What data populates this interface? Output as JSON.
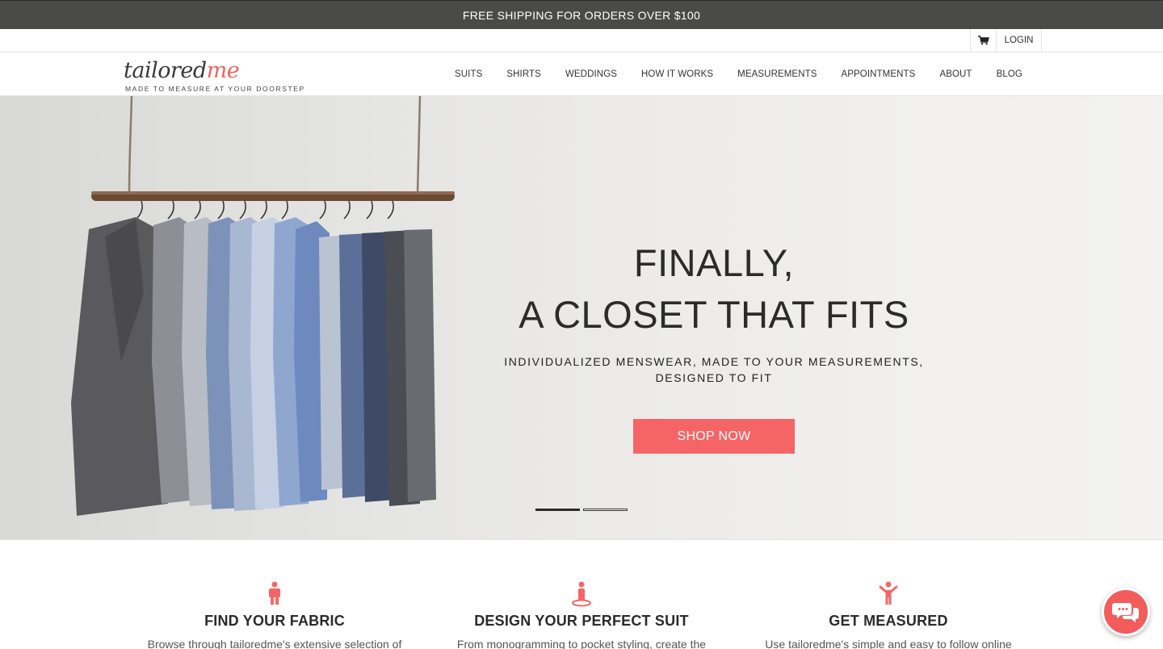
{
  "promo": {
    "text": "FREE SHIPPING FOR ORDERS OVER $100"
  },
  "utility": {
    "cart_icon": "cart-icon",
    "login_label": "LOGIN"
  },
  "logo": {
    "word_main": "tailored",
    "word_accent": "me",
    "tagline": "MADE TO MEASURE AT YOUR DOORSTEP"
  },
  "nav": {
    "items": [
      {
        "label": "SUITS"
      },
      {
        "label": "SHIRTS"
      },
      {
        "label": "WEDDINGS"
      },
      {
        "label": "HOW IT WORKS"
      },
      {
        "label": "MEASUREMENTS"
      },
      {
        "label": "APPOINTMENTS"
      },
      {
        "label": "ABOUT"
      },
      {
        "label": "BLOG"
      }
    ]
  },
  "hero": {
    "title_line1": "FINALLY,",
    "title_line2": "A CLOSET THAT FITS",
    "subtitle_line1": "INDIVIDUALIZED MENSWEAR, MADE TO YOUR MEASUREMENTS,",
    "subtitle_line2": "DESIGNED TO FIT",
    "cta_label": "SHOP NOW",
    "slide_count": 2,
    "active_slide": 1
  },
  "features": [
    {
      "icon": "person-icon",
      "title": "FIND YOUR FABRIC",
      "text": "Browse through tailoredme's extensive selection of"
    },
    {
      "icon": "person-pin-icon",
      "title": "DESIGN YOUR PERFECT SUIT",
      "text": "From monogramming to pocket styling, create the"
    },
    {
      "icon": "person-arms-up-icon",
      "title": "GET MEASURED",
      "text": "Use tailoredme's simple and easy to follow online"
    }
  ],
  "chat": {
    "icon": "chat-bubbles-icon"
  },
  "colors": {
    "accent": "#f66566",
    "promo_bg": "#4a4a49",
    "text_dark": "#2b2b2b"
  }
}
